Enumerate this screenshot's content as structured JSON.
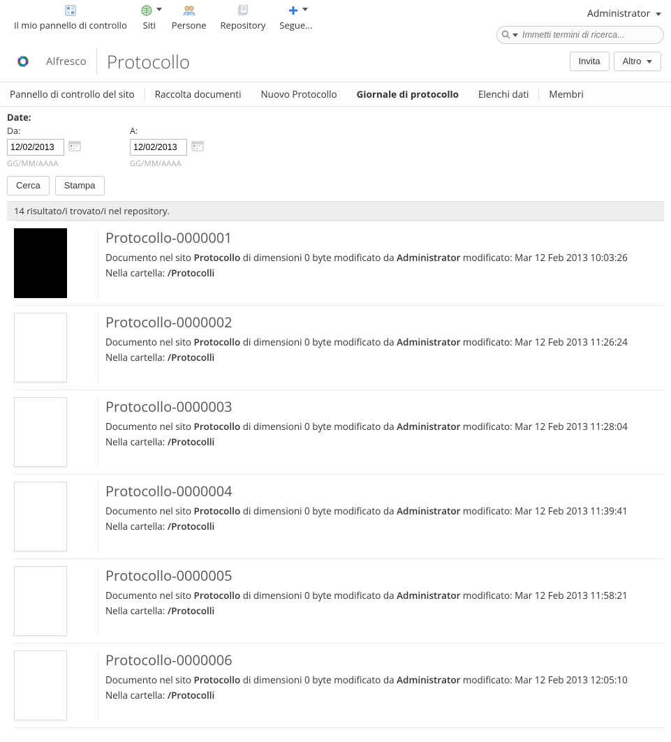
{
  "toolbar": {
    "dashboard": "Il mio pannello di controllo",
    "sites": "Siti",
    "people": "Persone",
    "repository": "Repository",
    "follow": "Segue..."
  },
  "user": {
    "name": "Administrator"
  },
  "search": {
    "placeholder": "Immetti termini di ricerca..."
  },
  "brand": "Alfresco",
  "site_name": "Protocollo",
  "buttons": {
    "invite": "Invita",
    "other": "Altro"
  },
  "sitenav": {
    "dashboard": "Pannello di controllo del sito",
    "doclib": "Raccolta documenti",
    "nuovo": "Nuovo Protocollo",
    "giornale": "Giornale di protocollo",
    "elenchi": "Elenchi dati",
    "membri": "Membri"
  },
  "filter": {
    "title": "Date:",
    "from_label": "Da:",
    "to_label": "A:",
    "from_value": "12/02/2013",
    "to_value": "12/02/2013",
    "format_hint": "GG/MM/AAAA",
    "search": "Cerca",
    "print": "Stampa"
  },
  "results_summary": "14 risultato/i trovato/i nel repository.",
  "meta_text": {
    "prefix": "Documento nel sito ",
    "mid1": " di dimensioni 0 byte modificato da ",
    "mid2": " modificato: ",
    "folder_prefix": "Nella cartella: "
  },
  "results": [
    {
      "title": "Protocollo-0000001",
      "site": "Protocollo",
      "user": "Administrator",
      "ts": "Mar 12 Feb 2013 10:03:26",
      "folder": "/Protocolli",
      "black_thumb": true
    },
    {
      "title": "Protocollo-0000002",
      "site": "Protocollo",
      "user": "Administrator",
      "ts": "Mar 12 Feb 2013 11:26:24",
      "folder": "/Protocolli",
      "black_thumb": false
    },
    {
      "title": "Protocollo-0000003",
      "site": "Protocollo",
      "user": "Administrator",
      "ts": "Mar 12 Feb 2013 11:28:04",
      "folder": "/Protocolli",
      "black_thumb": false
    },
    {
      "title": "Protocollo-0000004",
      "site": "Protocollo",
      "user": "Administrator",
      "ts": "Mar 12 Feb 2013 11:39:41",
      "folder": "/Protocolli",
      "black_thumb": false
    },
    {
      "title": "Protocollo-0000005",
      "site": "Protocollo",
      "user": "Administrator",
      "ts": "Mar 12 Feb 2013 11:58:21",
      "folder": "/Protocolli",
      "black_thumb": false
    },
    {
      "title": "Protocollo-0000006",
      "site": "Protocollo",
      "user": "Administrator",
      "ts": "Mar 12 Feb 2013 12:05:10",
      "folder": "/Protocolli",
      "black_thumb": false
    }
  ]
}
